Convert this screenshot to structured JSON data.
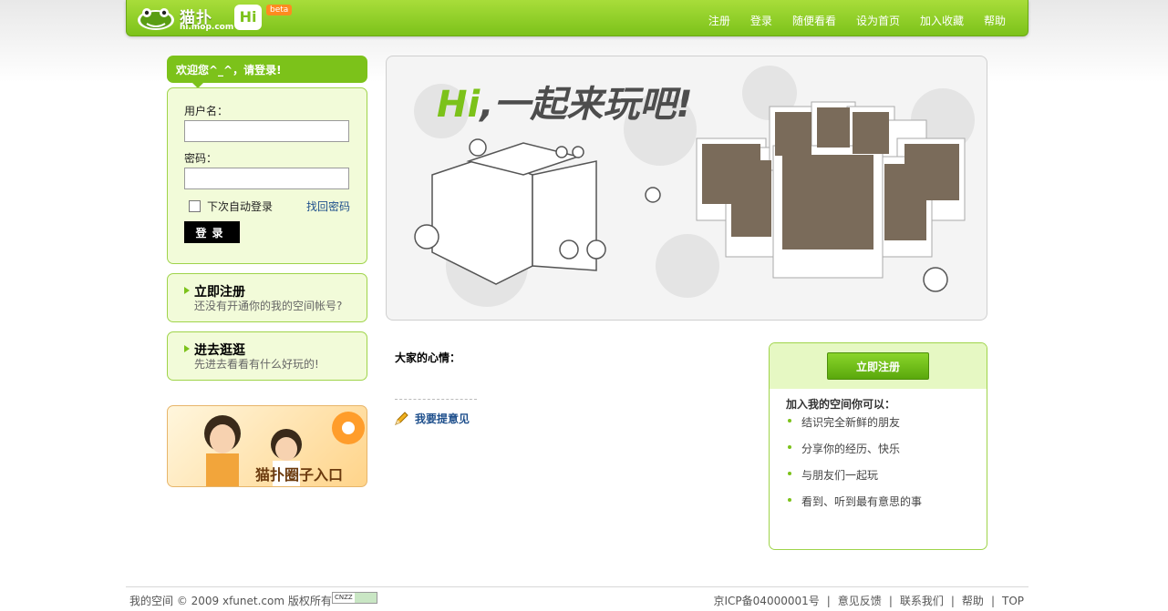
{
  "header": {
    "logo_name": "猫扑",
    "logo_domain": "hi.mop.com",
    "logo_hi": "Hi",
    "beta": "beta",
    "nav": [
      "注册",
      "登录",
      "随便看看",
      "设为首页",
      "加入收藏",
      "帮助"
    ]
  },
  "login": {
    "greeting": "欢迎您^_^，请登录!",
    "username_label": "用户名：",
    "username_value": "",
    "password_label": "密码：",
    "password_value": "",
    "remember_label": "下次自动登录",
    "forgot_label": "找回密码",
    "submit_label": "登录"
  },
  "promo_register": {
    "title": "立即注册",
    "subtitle": "还没有开通你的我的空间帐号?"
  },
  "promo_browse": {
    "title": "进去逛逛",
    "subtitle": "先进去看看有什么好玩的!"
  },
  "circle_banner": {
    "text": "猫扑圈子入口"
  },
  "hero": {
    "slogan_hi": "Hi",
    "slogan_rest": ",一起来玩吧!"
  },
  "mood": {
    "title": "大家的心情：",
    "feedback": "我要提意见"
  },
  "register_box": {
    "button": "立即注册",
    "subtitle": "加入我的空间你可以：",
    "items": [
      "结识完全新鲜的朋友",
      "分享你的经历、快乐",
      "与朋友们一起玩",
      "看到、听到最有意思的事"
    ]
  },
  "footer": {
    "left": "我的空间 © 2009 xfunet.com 版权所有",
    "cnzz": "CNZZ",
    "icp": "京ICP备04000001号",
    "links": [
      "意见反馈",
      "联系我们",
      "帮助",
      "TOP"
    ]
  },
  "colors": {
    "brand_green": "#7cc21a",
    "link_blue": "#1e4f8c",
    "panel_bg": "#f2fbd9"
  }
}
